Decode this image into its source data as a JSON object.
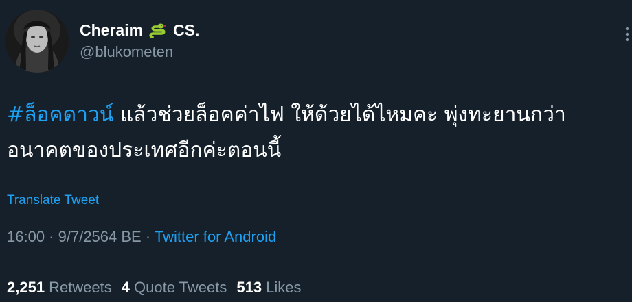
{
  "author": {
    "display_name": "Cheraim",
    "display_name_suffix": "CS.",
    "name_emoji": "snake-emoji",
    "handle": "@blukometen"
  },
  "tweet": {
    "hashtag": "#ล็อคดาวน์",
    "text_line1_rest": " แล้วช่วยล็อคค่าไฟ ให้ด้วยได้ไหมคะ พุ่งทะยานกว่า",
    "text_line2": "อนาคตของประเทศอีกค่ะตอนนี้",
    "translate_label": "Translate Tweet"
  },
  "meta": {
    "time": "16:00",
    "sep1": " · ",
    "date": "9/7/2564 BE",
    "sep2": " · ",
    "source": "Twitter for Android"
  },
  "stats": {
    "retweets_count": "2,251",
    "retweets_label": "Retweets",
    "quotes_count": "4",
    "quotes_label": "Quote Tweets",
    "likes_count": "513",
    "likes_label": "Likes"
  },
  "colors": {
    "background": "#15202b",
    "link": "#1da1f2",
    "secondary_text": "#8899a6",
    "primary_text": "#ffffff",
    "divider": "#38444d"
  }
}
